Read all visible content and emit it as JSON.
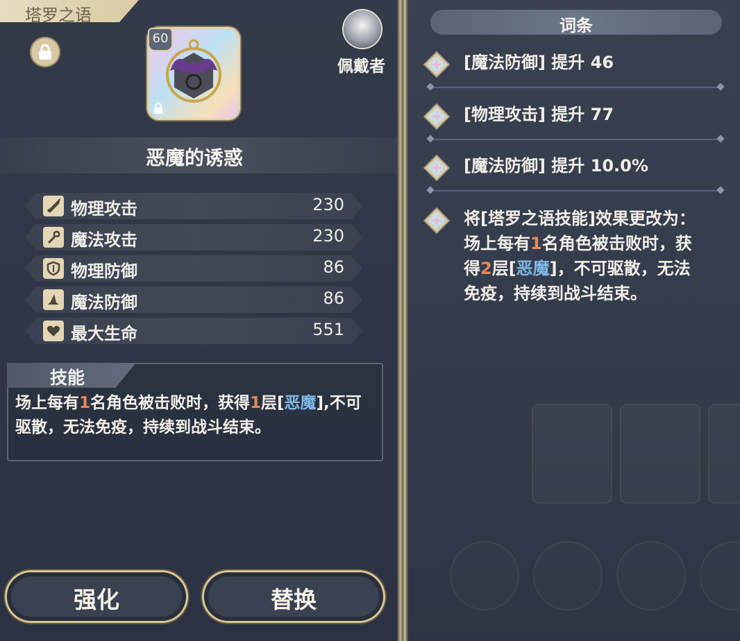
{
  "header": {
    "tab_title": "塔罗之语"
  },
  "card": {
    "level": "60",
    "name": "恶魔的诱惑",
    "wearer_label": "佩戴者"
  },
  "stats": [
    {
      "label": "物理攻击",
      "value": "230",
      "icon": "sword-icon"
    },
    {
      "label": "魔法攻击",
      "value": "230",
      "icon": "staff-icon"
    },
    {
      "label": "物理防御",
      "value": "86",
      "icon": "shield-icon"
    },
    {
      "label": "魔法防御",
      "value": "86",
      "icon": "wizard-hat-icon"
    },
    {
      "label": "最大生命",
      "value": "551",
      "icon": "heart-icon"
    }
  ],
  "skill": {
    "title": "技能",
    "text_1": "场上每有",
    "num_1": "1",
    "text_2": "名角色被击败时，获得",
    "num_2": "1",
    "text_3": "层[",
    "keyword": "恶魔",
    "text_4": "],不可驱散，无法免疫，持续到战斗结束。"
  },
  "buttons": {
    "enhance": "强化",
    "replace": "替换"
  },
  "terms": {
    "title": "词条",
    "items": [
      {
        "text": "[魔法防御] 提升 46"
      },
      {
        "text": "[物理攻击] 提升 77"
      },
      {
        "text": "[魔法防御] 提升 10.0%"
      }
    ],
    "special": {
      "text_1": "将[塔罗之语技能]效果更改为：场上每有",
      "num_1": "1",
      "text_2": "名角色被击败时，获得",
      "num_2": "2",
      "text_3": "层[",
      "keyword": "恶魔",
      "text_4": "]，不可驱散，无法免疫，持续到战斗结束。"
    }
  },
  "colors": {
    "accent_gold": "#d8c896",
    "highlight_number": "#e38a5c",
    "highlight_keyword": "#7fb8e8"
  }
}
